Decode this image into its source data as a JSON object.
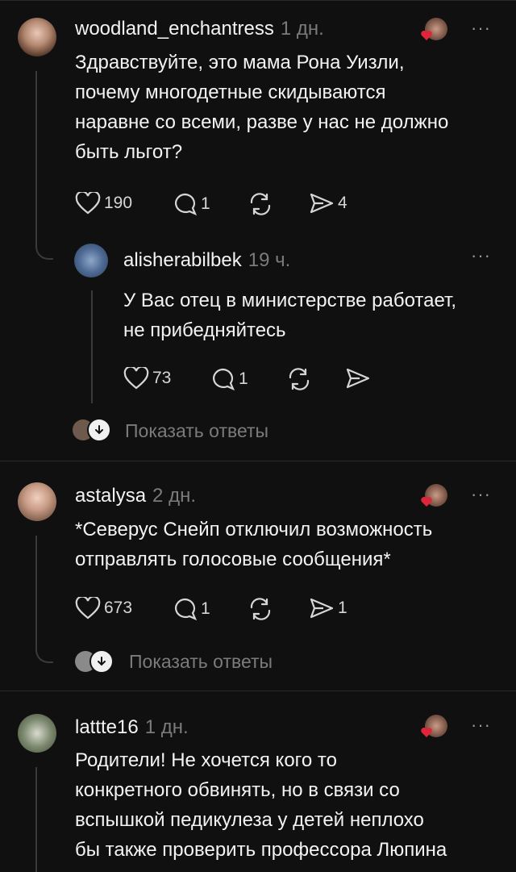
{
  "comments": [
    {
      "username": "woodland_enchantress",
      "time": "1 дн.",
      "text_lines": [
        "Здравствуйте, это мама Рона Уизли,",
        "почему многодетные скидываются",
        "наравне со всеми, разве у нас не должно",
        "быть льгот?"
      ],
      "likes": "190",
      "replies": "1",
      "reposts": "",
      "shares": "4",
      "more": "···",
      "reply": {
        "username": "alisherabilbek",
        "time": "19 ч.",
        "text_lines": [
          "У Вас отец в министерстве работает,",
          "не прибедняйтесь"
        ],
        "likes": "73",
        "replies": "1",
        "more": "···"
      },
      "show_replies": "Показать ответы"
    },
    {
      "username": "astalysa",
      "time": "2 дн.",
      "text_lines": [
        "*Северус Снейп отключил возможность",
        "отправлять голосовые сообщения*"
      ],
      "likes": "673",
      "replies": "1",
      "shares": "1",
      "more": "···",
      "show_replies": "Показать ответы"
    },
    {
      "username": "lattte16",
      "time": "1 дн.",
      "text_lines": [
        "Родители! Не хочется кого то",
        "конкретного обвинять, но в связи со",
        "вспышкой педикулеза у детей неплохо",
        "бы также проверить профессора Люпина"
      ],
      "more": "···"
    }
  ],
  "icons": {
    "heart": "heart-icon",
    "comment": "comment-icon",
    "repost": "repost-icon",
    "share": "share-icon",
    "more": "more-icon",
    "liked_by_author": "liked-by-author-icon"
  },
  "colors": {
    "background": "#101010",
    "text": "#f3f3f3",
    "muted": "#7b7b7b",
    "heart_red": "#e0253a"
  }
}
